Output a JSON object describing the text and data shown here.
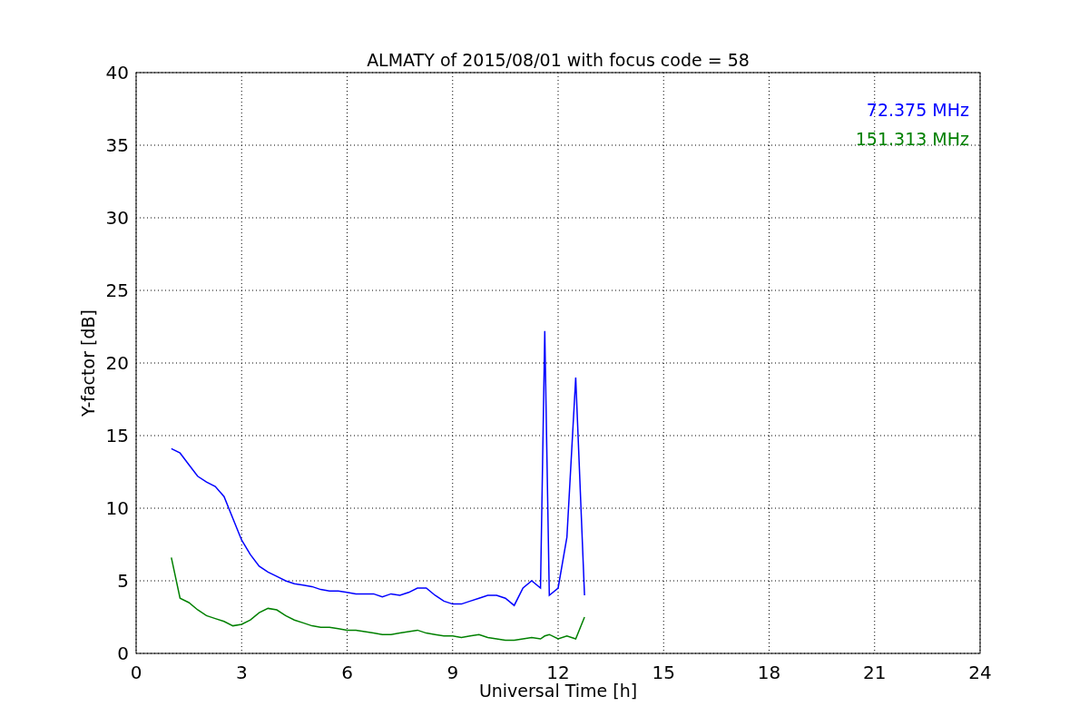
{
  "figure": {
    "chart_data": {
      "type": "line",
      "title": "ALMATY of 2015/08/01 with focus code = 58",
      "xlabel": "Universal Time [h]",
      "ylabel": "Y-factor [dB]",
      "x": [
        1,
        1.25,
        1.5,
        1.75,
        2,
        2.25,
        2.5,
        2.75,
        3,
        3.25,
        3.5,
        3.75,
        4,
        4.25,
        4.5,
        4.75,
        5,
        5.25,
        5.5,
        5.75,
        6,
        6.25,
        6.5,
        6.75,
        7,
        7.25,
        7.5,
        7.75,
        8,
        8.25,
        8.5,
        8.75,
        9,
        9.25,
        9.5,
        9.75,
        10,
        10.25,
        10.5,
        10.75,
        11,
        11.25,
        11.5,
        11.62,
        11.75,
        12,
        12.25,
        12.5,
        12.75
      ],
      "series": [
        {
          "name": "72.375 MHz",
          "color": "#0000ff",
          "values": [
            14.1,
            13.8,
            13.0,
            12.2,
            11.8,
            11.5,
            10.8,
            9.3,
            7.8,
            6.8,
            6.0,
            5.6,
            5.3,
            5.0,
            4.8,
            4.7,
            4.6,
            4.4,
            4.3,
            4.3,
            4.2,
            4.1,
            4.1,
            4.1,
            3.9,
            4.1,
            4.0,
            4.2,
            4.5,
            4.5,
            4.0,
            3.6,
            3.4,
            3.4,
            3.6,
            3.8,
            4.0,
            4.0,
            3.8,
            3.3,
            4.5,
            5.0,
            4.5,
            22.2,
            4.0,
            4.5,
            8.0,
            19.0,
            4.0
          ]
        },
        {
          "name": "151.313 MHz",
          "color": "#008000",
          "values": [
            6.6,
            3.8,
            3.5,
            3.0,
            2.6,
            2.4,
            2.2,
            1.9,
            2.0,
            2.3,
            2.8,
            3.1,
            3.0,
            2.6,
            2.3,
            2.1,
            1.9,
            1.8,
            1.8,
            1.7,
            1.6,
            1.6,
            1.5,
            1.4,
            1.3,
            1.3,
            1.4,
            1.5,
            1.6,
            1.4,
            1.3,
            1.2,
            1.2,
            1.1,
            1.2,
            1.3,
            1.1,
            1.0,
            0.9,
            0.9,
            1.0,
            1.1,
            1.0,
            1.2,
            1.3,
            1.0,
            1.2,
            1.0,
            2.5
          ]
        }
      ],
      "xlim": [
        0,
        24
      ],
      "ylim": [
        0,
        40
      ],
      "grid": true,
      "xticks": [
        0,
        3,
        6,
        9,
        12,
        15,
        18,
        21,
        24
      ],
      "yticks": [
        0,
        5,
        10,
        15,
        20,
        25,
        30,
        35,
        40
      ]
    }
  }
}
